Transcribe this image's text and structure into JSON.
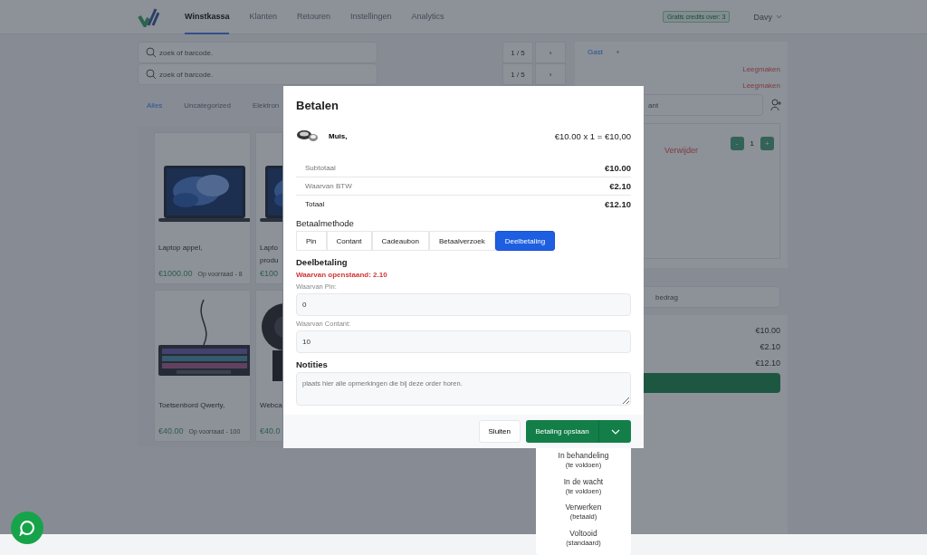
{
  "nav": {
    "items": [
      {
        "label": "Winstkassa",
        "selected": true
      },
      {
        "label": "Klanten",
        "selected": false
      },
      {
        "label": "Retouren",
        "selected": false
      },
      {
        "label": "Instellingen",
        "selected": false
      },
      {
        "label": "Analytics",
        "selected": false
      }
    ],
    "credits": "Gratis credits over: 3",
    "user": "Davy"
  },
  "search_rows": [
    {
      "placeholder": "zoek of barcode.",
      "page": "1 / 5",
      "next": "›"
    },
    {
      "placeholder": "zoek of barcode.",
      "page": "1 / 5",
      "next": "›"
    }
  ],
  "categories": [
    {
      "label": "Alles",
      "selected": true
    },
    {
      "label": "Uncategorized",
      "selected": false
    },
    {
      "label": "Elektron",
      "selected": false
    }
  ],
  "products": [
    {
      "kind": "laptop",
      "name_lines": [
        "Laptop appel,"
      ],
      "price": "€1000.00",
      "stock": "Op voorraad - 8"
    },
    {
      "kind": "laptop",
      "name_lines": [
        "Lapto",
        "produ"
      ],
      "price": "€100"
    },
    {
      "kind": "keyboard",
      "name_lines": [
        "Toetsenbord Qwerty,"
      ],
      "price": "€40.00",
      "stock": "Op voorraad - 100"
    },
    {
      "kind": "webcam",
      "name_lines": [
        "Webca"
      ],
      "price": "€40.0"
    }
  ],
  "cart": {
    "customer_tab": "Gast",
    "add_tab": "+",
    "clear_links": [
      "Leegmaken",
      "Leegmaken"
    ],
    "customer_search": {
      "placeholder": "ant"
    },
    "item": {
      "remove": "Verwijder",
      "minus": "-",
      "qty": "1",
      "plus": "+"
    },
    "amount": {
      "placeholder": "bedrag"
    },
    "totals": [
      "€10.00",
      "€2.10",
      "€12.10"
    ]
  },
  "modal": {
    "title": "Betalen",
    "line_item": {
      "name": "Muis,",
      "price": "€10.00 x 1 = €10,00"
    },
    "summary": [
      {
        "kind": "line",
        "label": "Subtotaal",
        "value": "€10.00"
      },
      {
        "kind": "line",
        "label": "Waarvan BTW",
        "value": "€2.10"
      },
      {
        "kind": "total",
        "label": "Totaal",
        "value": "€12.10"
      }
    ],
    "method_label": "Betaalmethode",
    "methods": [
      {
        "label": "Pin",
        "selected": false
      },
      {
        "label": "Contant",
        "selected": false
      },
      {
        "label": "Cadeaubon",
        "selected": false
      },
      {
        "label": "Betaalverzoek",
        "selected": false
      },
      {
        "label": "Deelbetaling",
        "selected": true
      }
    ],
    "section_title": "Deelbetaling",
    "outstanding": "Waarvan openstaand: 2.10",
    "fields": [
      {
        "label": "Waarvan Pin:",
        "value": "0"
      },
      {
        "label": "Waarvan Contant:",
        "value": "10"
      }
    ],
    "notes": {
      "label": "Notities",
      "placeholder": "plaats hier alle opmerkingen die bij deze order horen."
    },
    "close_button": "Sluiten",
    "save_button": "Betaling opslaan"
  },
  "dropdown": [
    {
      "label": "In behandeling",
      "note": "(te voldoen)"
    },
    {
      "label": "In de wacht",
      "note": "(te voldoen)"
    },
    {
      "label": "Verwerken",
      "note": "(betaald)"
    },
    {
      "label": "Voltooid",
      "note": "(standaard)"
    }
  ]
}
